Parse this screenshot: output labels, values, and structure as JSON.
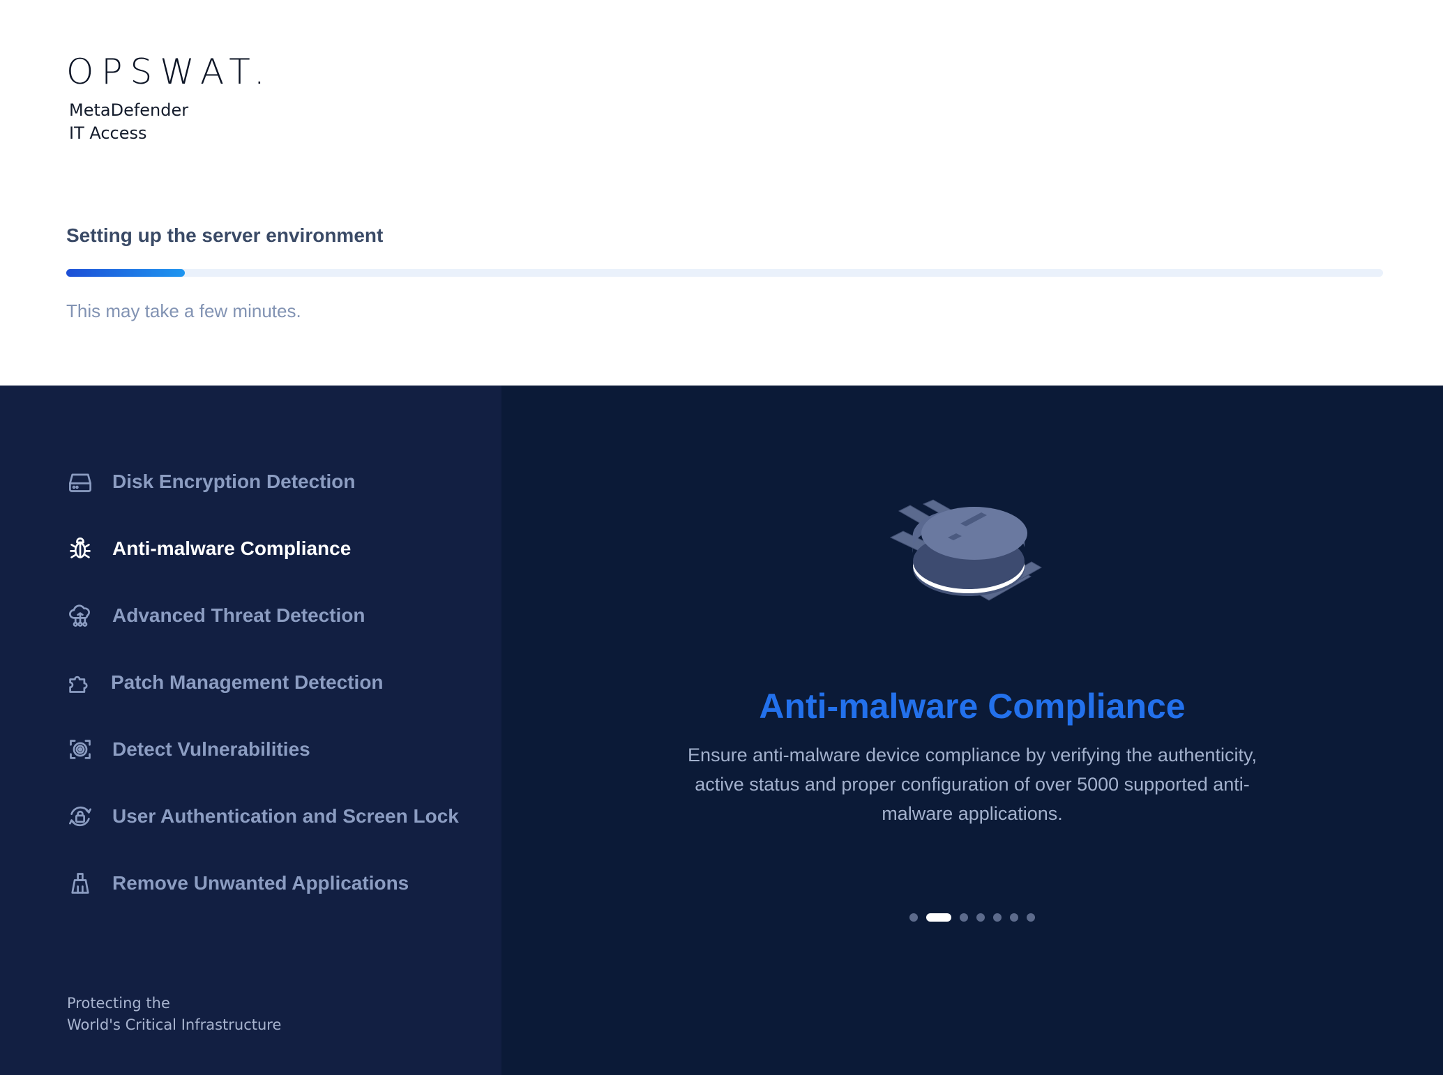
{
  "brand": {
    "logo": "OPSWAT.",
    "product_line1": "MetaDefender",
    "product_line2": "IT Access"
  },
  "setup": {
    "title": "Setting up the server environment",
    "progress_fraction": 0.09,
    "hint": "This may take a few minutes."
  },
  "features": [
    {
      "label": "Disk Encryption Detection",
      "icon": "disk-icon",
      "active": false
    },
    {
      "label": "Anti-malware Compliance",
      "icon": "bug-icon",
      "active": true
    },
    {
      "label": "Advanced Threat Detection",
      "icon": "cloud-network-icon",
      "active": false
    },
    {
      "label": "Patch Management Detection",
      "icon": "puzzle-icon",
      "active": false
    },
    {
      "label": "Detect Vulnerabilities",
      "icon": "target-scan-icon",
      "active": false
    },
    {
      "label": "User Authentication and Screen Lock",
      "icon": "lock-rotate-icon",
      "active": false
    },
    {
      "label": "Remove Unwanted Applications",
      "icon": "broom-icon",
      "active": false
    }
  ],
  "tagline": {
    "line1": "Protecting the",
    "line2": "World's Critical Infrastructure"
  },
  "slide": {
    "title": "Anti-malware Compliance",
    "description": "Ensure anti-malware device compliance by verifying the authenticity, active status and proper configuration of over 5000 supported anti-malware applications.",
    "illustration": "isometric-bug-icon"
  },
  "carousel": {
    "count": 7,
    "active_index": 1
  },
  "colors": {
    "sidebar_bg": "#121f42",
    "showcase_bg": "#0b1a37",
    "accent": "#2371ec",
    "progress_start": "#1d4fd6",
    "progress_end": "#1e96f0",
    "muted_text": "#8c9dc2"
  }
}
